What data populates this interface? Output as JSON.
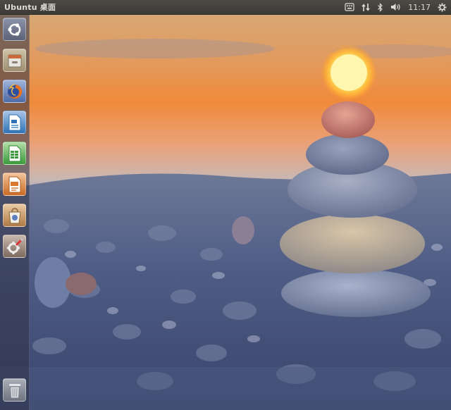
{
  "top_panel": {
    "app_title": "Ubuntu 桌面",
    "clock": "11:17",
    "indicators": [
      "keyboard-icon",
      "network-icon",
      "bluetooth-icon",
      "volume-icon",
      "gear-icon"
    ]
  },
  "launcher": {
    "items": [
      {
        "icon": "ubuntu-logo-icon",
        "color": "#6b7390"
      },
      {
        "icon": "files-icon",
        "color": "#b8a88a"
      },
      {
        "icon": "firefox-icon",
        "color": "#d85a1c"
      },
      {
        "icon": "writer-icon",
        "color": "#2f73b6"
      },
      {
        "icon": "calc-icon",
        "color": "#3a9a3a"
      },
      {
        "icon": "impress-icon",
        "color": "#c96a25"
      },
      {
        "icon": "software-center-icon",
        "color": "#b07a45"
      },
      {
        "icon": "settings-icon",
        "color": "#7c6a5e"
      },
      {
        "icon": "trash-icon",
        "color": "#7f8590"
      }
    ]
  },
  "colors": {
    "panel": "#3c3b37",
    "panel_text": "#dfdbd2",
    "sky_top": "#e2a15f",
    "sunset_orange": "#f08a3a",
    "sun": "#fff3a0"
  }
}
